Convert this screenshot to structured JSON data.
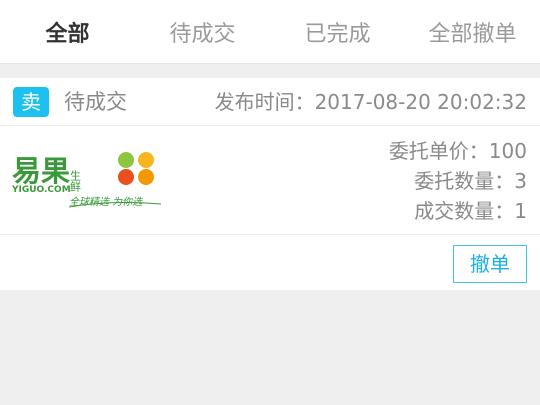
{
  "tabs": [
    {
      "label": "全部",
      "active": true
    },
    {
      "label": "待成交",
      "active": false
    },
    {
      "label": "已完成",
      "active": false
    },
    {
      "label": "全部撤单",
      "active": false
    }
  ],
  "order": {
    "type_badge": "卖",
    "status": "待成交",
    "publish_time": "发布时间：2017-08-20 20:02:32",
    "logo": {
      "brand_text": "易果",
      "brand_sub": "生鲜",
      "domain_text": "YIGUO.COM",
      "slogan": "全球精选 为你选",
      "dot_colors": [
        "#8cc63f",
        "#f7b520",
        "#e8501e",
        "#f39800"
      ]
    },
    "unit_price": "委托单价：100",
    "quantity": "委托数量：3",
    "filled_quantity": "成交数量：1",
    "cancel_label": "撤单"
  },
  "colors": {
    "accent": "#1ec0f0",
    "button_border": "#45c2e8",
    "text_gray": "#8a8a8a",
    "background": "#efefef"
  }
}
